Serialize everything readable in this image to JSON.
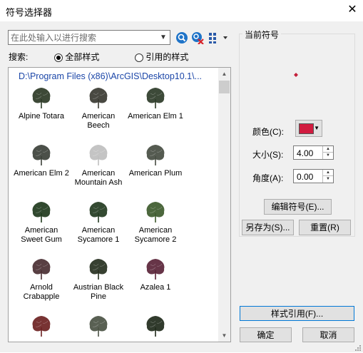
{
  "window": {
    "title": "符号选择器",
    "close_glyph": "✕"
  },
  "search": {
    "placeholder": "在此处输入以进行搜索",
    "value": ""
  },
  "toolbar": {
    "search_icon": "magnifier-icon",
    "clear_icon": "clear-search-icon",
    "view_icon": "view-options-icon"
  },
  "scope": {
    "label": "搜索:",
    "options": [
      {
        "label": "全部样式",
        "selected": true
      },
      {
        "label": "引用的样式",
        "selected": false
      }
    ]
  },
  "gallery": {
    "path": "D:\\Program Files (x86)\\ArcGIS\\Desktop10.1\\...",
    "items": [
      {
        "name": "Alpine Totara",
        "color": "#2c3a26"
      },
      {
        "name": "American Beech",
        "color": "#3a3a32"
      },
      {
        "name": "American Elm 1",
        "color": "#2d3b28"
      },
      {
        "name": "American Elm 2",
        "color": "#3c4139"
      },
      {
        "name": "American Mountain Ash",
        "color": "#bfbfbf"
      },
      {
        "name": "American Plum",
        "color": "#474d42"
      },
      {
        "name": "American Sweet Gum",
        "color": "#1f3a1d"
      },
      {
        "name": "American Sycamore 1",
        "color": "#233b21"
      },
      {
        "name": "American Sycamore 2",
        "color": "#3d5a2c"
      },
      {
        "name": "Arnold Crabapple",
        "color": "#4a2f33"
      },
      {
        "name": "Austrian Black Pine",
        "color": "#26301f"
      },
      {
        "name": "Azalea 1",
        "color": "#5a2438"
      },
      {
        "name": "",
        "color": "#6d2222"
      },
      {
        "name": "",
        "color": "#4b5244"
      },
      {
        "name": "",
        "color": "#1f2a1b"
      }
    ]
  },
  "current_symbol": {
    "group_title": "当前符号",
    "preview_color": "#c41e3a",
    "color_label": "颜色(C):",
    "color_value": "#d11b3f",
    "size_label": "大小(S):",
    "size_value": "4.00",
    "angle_label": "角度(A):",
    "angle_value": "0.00",
    "edit_button": "编辑符号(E)...",
    "save_as_button": "另存为(S)...",
    "reset_button": "重置(R)"
  },
  "footer": {
    "style_refs_button": "样式引用(F)...",
    "ok_button": "确定",
    "cancel_button": "取消"
  }
}
